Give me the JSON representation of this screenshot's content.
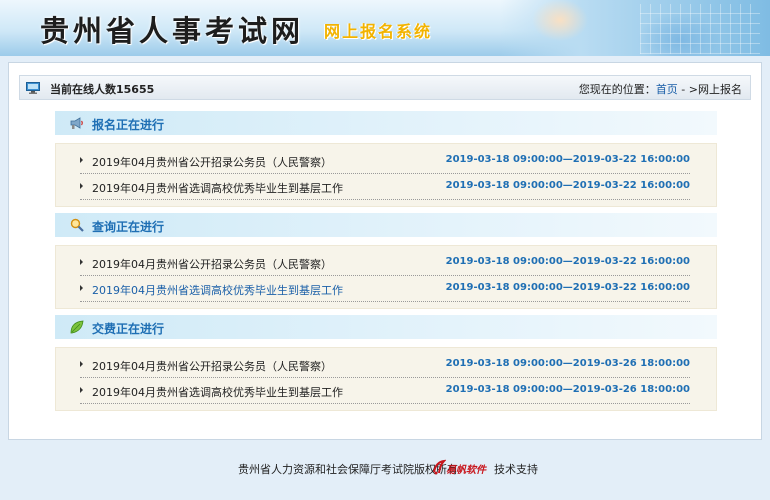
{
  "banner": {
    "title": "贵州省人事考试网",
    "subtitle": "网上报名系统"
  },
  "status": {
    "online_text": "当前在线人数15655",
    "location_prefix": "您现在的位置：",
    "home_link": "首页",
    "separator": " - >",
    "current": "网上报名"
  },
  "sections": [
    {
      "title": "报名正在进行",
      "icon": "megaphone-icon",
      "items": [
        {
          "name": "2019年04月贵州省公开招录公务员（人民警察）",
          "time": "2019-03-18 09:00:00—2019-03-22 16:00:00"
        },
        {
          "name": "2019年04月贵州省选调高校优秀毕业生到基层工作",
          "time": "2019-03-18 09:00:00—2019-03-22 16:00:00"
        }
      ]
    },
    {
      "title": "查询正在进行",
      "icon": "magnifier-icon",
      "items": [
        {
          "name": "2019年04月贵州省公开招录公务员（人民警察）",
          "time": "2019-03-18 09:00:00—2019-03-22 16:00:00"
        },
        {
          "name": "2019年04月贵州省选调高校优秀毕业生到基层工作",
          "time": "2019-03-18 09:00:00—2019-03-22 16:00:00"
        }
      ]
    },
    {
      "title": "交费正在进行",
      "icon": "leaf-icon",
      "items": [
        {
          "name": "2019年04月贵州省公开招录公务员（人民警察）",
          "time": "2019-03-18 09:00:00—2019-03-26 18:00:00"
        },
        {
          "name": "2019年04月贵州省选调高校优秀毕业生到基层工作",
          "time": "2019-03-18 09:00:00—2019-03-26 18:00:00"
        }
      ]
    }
  ],
  "footer": {
    "copyright": "贵州省人力资源和社会保障厅考试院版权所有",
    "logo_text": "易帆软件",
    "support": "技术支持"
  },
  "colors": {
    "accent_blue": "#1f6fb4",
    "link_blue": "#1a5fa8",
    "subtitle_gold": "#f2b300",
    "section_bg": "#f7f4ea"
  }
}
